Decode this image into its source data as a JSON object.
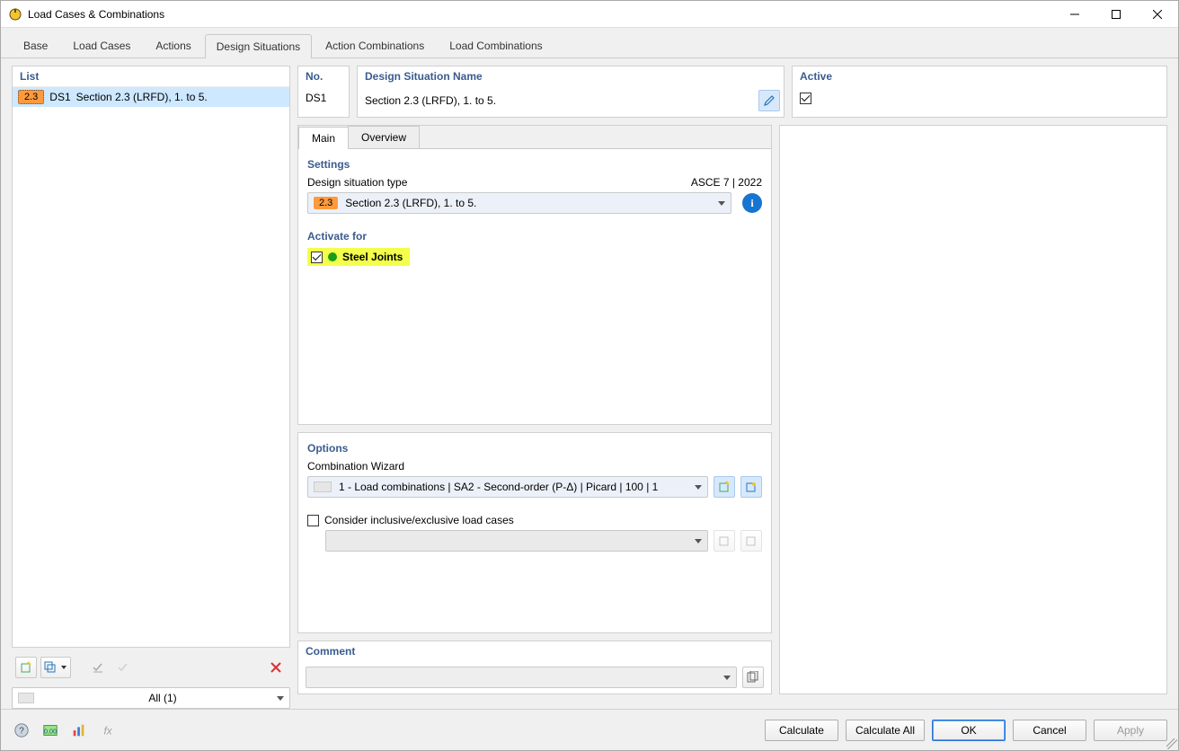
{
  "titlebar": {
    "title": "Load Cases & Combinations"
  },
  "tabs": {
    "items": [
      "Base",
      "Load Cases",
      "Actions",
      "Design Situations",
      "Action Combinations",
      "Load Combinations"
    ],
    "activeIndex": 3
  },
  "list": {
    "header": "List",
    "rows": [
      {
        "badge": "2.3",
        "id": "DS1",
        "name": "Section 2.3 (LRFD), 1. to 5."
      }
    ],
    "filter": "All (1)"
  },
  "header": {
    "no_label": "No.",
    "no_value": "DS1",
    "name_label": "Design Situation Name",
    "name_value": "Section 2.3 (LRFD), 1. to 5.",
    "active_label": "Active",
    "active_checked": true
  },
  "subtabs": {
    "items": [
      "Main",
      "Overview"
    ],
    "activeIndex": 0
  },
  "settings": {
    "title": "Settings",
    "type_label": "Design situation type",
    "code": "ASCE 7 | 2022",
    "type_badge": "2.3",
    "type_value": "Section 2.3 (LRFD), 1. to 5."
  },
  "activate": {
    "title": "Activate for",
    "items": [
      {
        "label": "Steel Joints",
        "checked": true
      }
    ]
  },
  "options": {
    "title": "Options",
    "wizard_label": "Combination Wizard",
    "wizard_value": "1 - Load combinations | SA2 - Second-order (P-Δ) | Picard | 100 | 1",
    "consider_label": "Consider inclusive/exclusive load cases",
    "consider_checked": false
  },
  "comment": {
    "title": "Comment",
    "value": ""
  },
  "footer": {
    "calculate": "Calculate",
    "calculate_all": "Calculate All",
    "ok": "OK",
    "cancel": "Cancel",
    "apply": "Apply"
  }
}
